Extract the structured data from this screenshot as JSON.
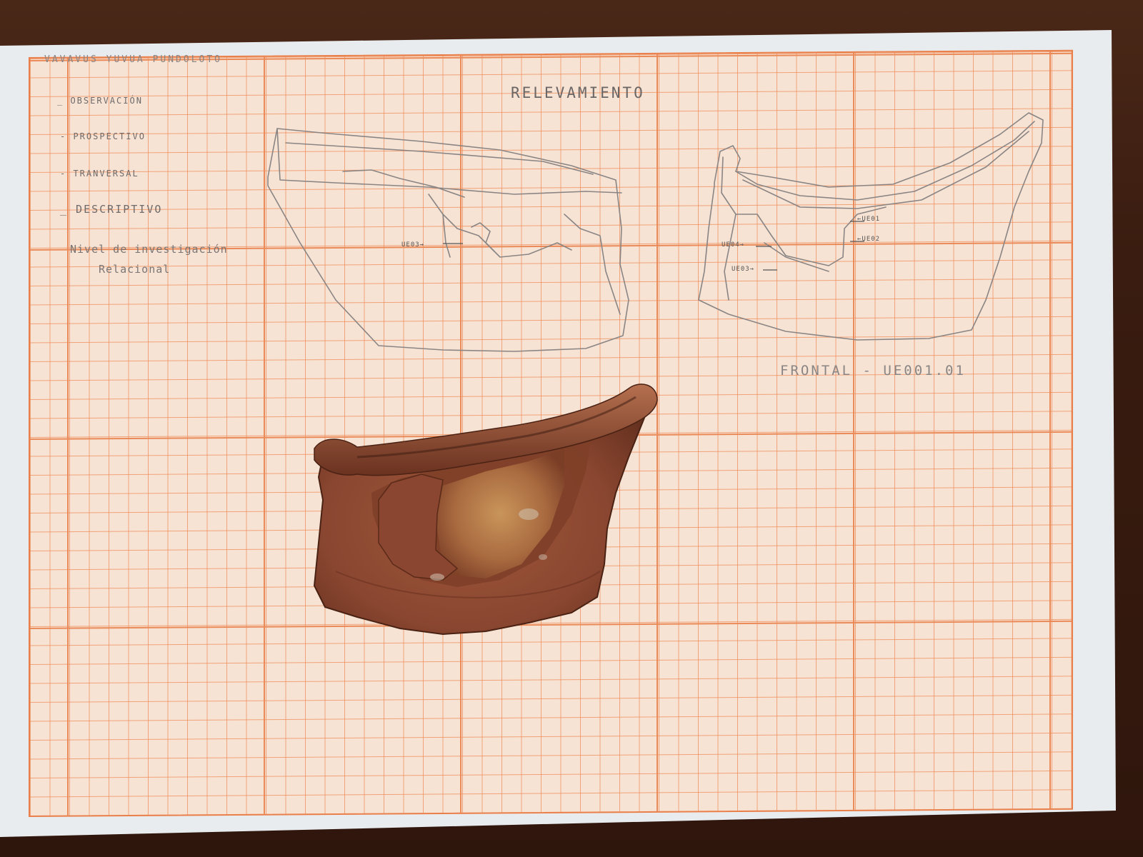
{
  "sheet": {
    "header_line": "VAVAVUS YUVUA PUNDOLOTO",
    "title": "RELEVAMIENTO",
    "list": [
      "_ OBSERVACIÓN",
      "- PROSPECTIVO",
      "- TRANVERSAL",
      "_ DESCRIPTIVO"
    ],
    "research_level_label": "Nivel de investigación",
    "research_level_value": "Relacional",
    "sketch_labels": {
      "left": "UE03→",
      "right_top": "←UE01",
      "right_mid": "←UE02",
      "right_left": "UE04→",
      "right_bottom": "UE03→"
    },
    "caption": "FRONTAL - UE001.01"
  },
  "colors": {
    "grid_line": "#ea8a58",
    "paper": "#f7e3d3",
    "pencil": "#6f6a6a",
    "pottery": "#8a4a34",
    "table": "#3a1c10"
  }
}
